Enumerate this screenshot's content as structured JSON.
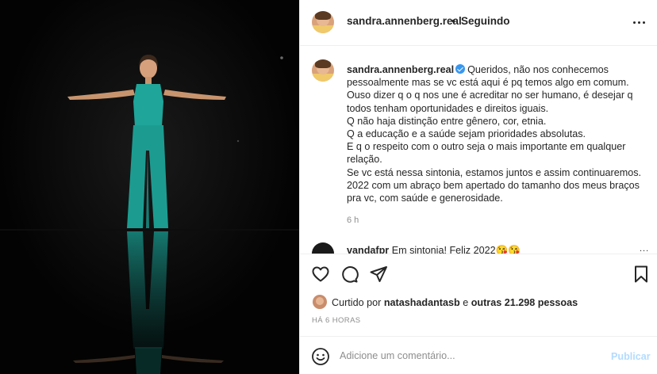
{
  "post": {
    "author": "sandra.annenberg.real",
    "separator": "•",
    "follow_status": "Seguindo",
    "icons": {
      "options": "more-horizontal-icon",
      "verified": "verified-badge-icon"
    }
  },
  "caption": {
    "author": "sandra.annenberg.real",
    "lines": [
      "Queridos, não nos conhecemos",
      "pessoalmente mas se vc está aqui é pq temos algo em comum.",
      "Ouso dizer q o q nos une é acreditar no ser humano, é desejar q",
      "todos tenham oportunidades e direitos iguais.",
      "Q não haja distinção entre gênero, cor, etnia.",
      "Q a educação e a saúde sejam prioridades absolutas.",
      "E q o respeito com o outro seja o mais importante em qualquer",
      "relação.",
      "Se vc está nessa sintonia, estamos juntos e assim continuaremos.",
      "2022 com um abraço bem apertado do tamanho dos meus braços",
      "pra vc, com saúde e generosidade."
    ],
    "time": "6 h"
  },
  "comment": {
    "author": "vandafpr",
    "text": "Em sintonia! Feliz 2022😘😘",
    "more": "..."
  },
  "actions": {
    "like_icon": "heart-icon",
    "comment_icon": "comment-bubble-icon",
    "share_icon": "paper-plane-icon",
    "save_icon": "bookmark-icon"
  },
  "likes": {
    "prefix": "Curtido por",
    "user": "natashadantasb",
    "connector": "e",
    "others": "outras 21.298 pessoas"
  },
  "posted_ago": "HÁ 6 HORAS",
  "composer": {
    "emoji_icon": "emoji-smile-icon",
    "placeholder": "Adicione um comentário...",
    "post_label": "Publicar",
    "post_color": "#b3dbff"
  },
  "colors": {
    "text": "#262626",
    "muted": "#8e8e8e",
    "verified": "#3897f0",
    "dress": "#1fa59a"
  }
}
